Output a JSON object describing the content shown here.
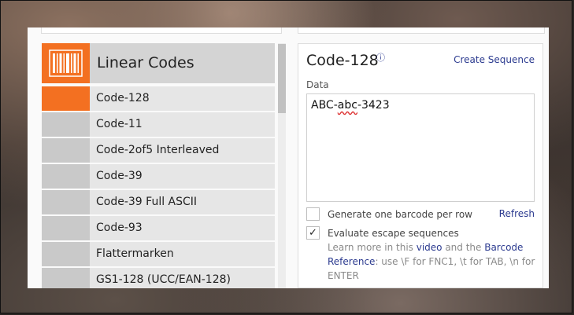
{
  "list": {
    "header_title": "Linear Codes",
    "items": [
      "Code-128",
      "Code-11",
      "Code-2of5 Interleaved",
      "Code-39",
      "Code-39 Full ASCII",
      "Code-93",
      "Flattermarken",
      "GS1-128 (UCC/EAN-128)"
    ],
    "active_index": 0
  },
  "panel": {
    "title": "Code-128",
    "info_icon": "ⓘ",
    "create_link": "Create Sequence",
    "data_label": "Data",
    "data_value_prefix": "ABC-",
    "data_value_misspelled": "abc",
    "data_value_suffix": "-3423",
    "option_per_row": "Generate one barcode per row",
    "option_per_row_checked": false,
    "refresh_link": "Refresh",
    "option_escape": "Evaluate escape sequences",
    "option_escape_checked": true,
    "checkmark": "✓",
    "help_1": "Learn more in this ",
    "help_link_video": "video",
    "help_2": " and the ",
    "help_link_reference_1": "Barcode",
    "help_link_reference_2": "Reference",
    "help_3": ": use \\F for FNC1, \\t for TAB, \\n for ENTER"
  },
  "colors": {
    "accent": "#f37021",
    "link": "#2b3a8f"
  }
}
